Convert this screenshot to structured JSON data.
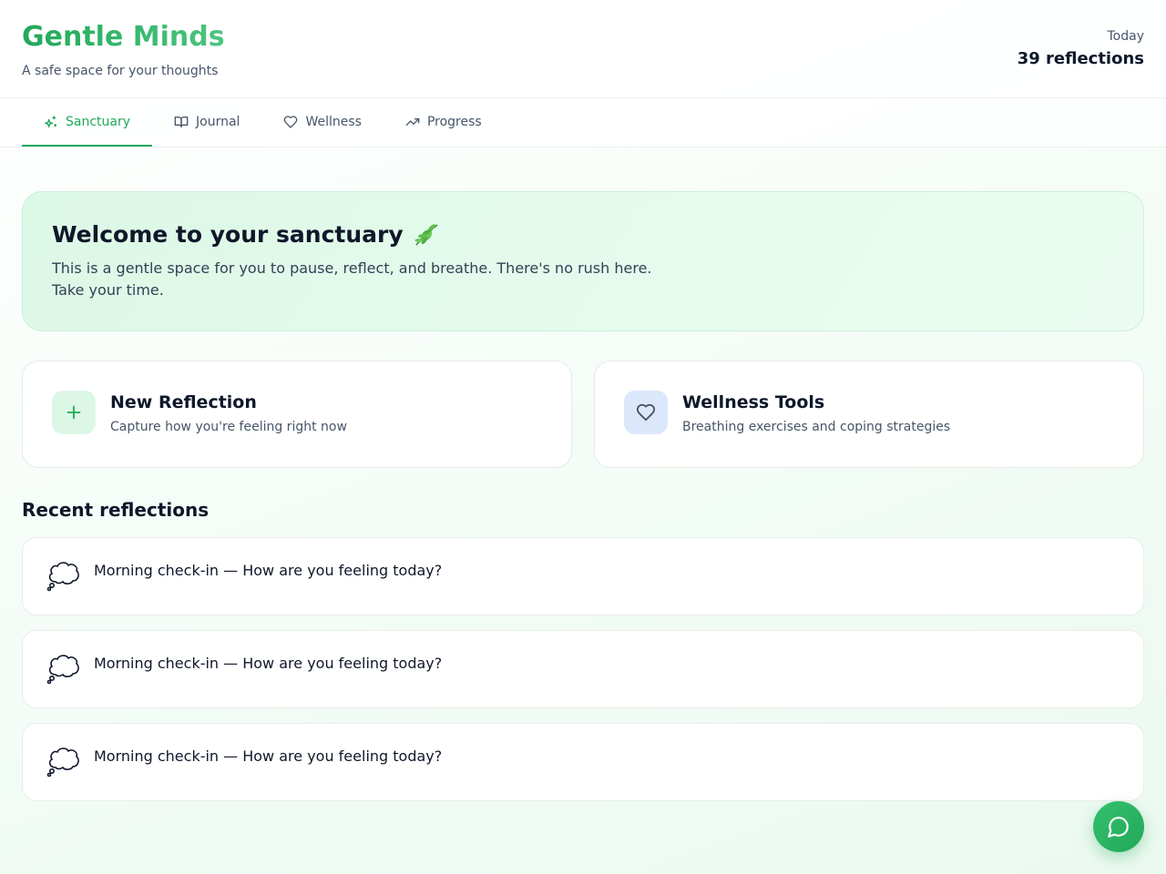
{
  "header": {
    "title": "Gentle Minds",
    "subtitle": "A safe space for your thoughts",
    "stats_label": "Today",
    "stats_value": "39 reflections"
  },
  "tabs": [
    {
      "label": "Sanctuary",
      "icon": "sparkles-icon",
      "active": true
    },
    {
      "label": "Journal",
      "icon": "book-open-icon",
      "active": false
    },
    {
      "label": "Wellness",
      "icon": "heart-icon",
      "active": false
    },
    {
      "label": "Progress",
      "icon": "trending-up-icon",
      "active": false
    }
  ],
  "hero": {
    "title": "Welcome to your sanctuary",
    "emoji_icon": "leaf-icon",
    "text": "This is a gentle space for you to pause, reflect, and breathe. There's no rush here. Take your time."
  },
  "cards": [
    {
      "title": "New Reflection",
      "description": "Capture how you're feeling right now",
      "icon": "plus-icon"
    },
    {
      "title": "Wellness Tools",
      "description": "Breathing exercises and coping strategies",
      "icon": "heart-icon"
    }
  ],
  "recent": {
    "title": "Recent reflections",
    "items": [
      {
        "text": "Morning check-in — How are you feeling today?",
        "icon": "thought-bubble-icon"
      },
      {
        "text": "Morning check-in — How are you feeling today?",
        "icon": "thought-bubble-icon"
      },
      {
        "text": "Morning check-in — How are you feeling today?",
        "icon": "thought-bubble-icon"
      }
    ]
  },
  "fab": {
    "icon": "chat-bubble-icon"
  },
  "colors": {
    "accent": "#22a85a",
    "hero_bg": "#dcf8e6",
    "card_icon_green": "#dcf7e6",
    "card_icon_blue": "#dbe7fb"
  }
}
